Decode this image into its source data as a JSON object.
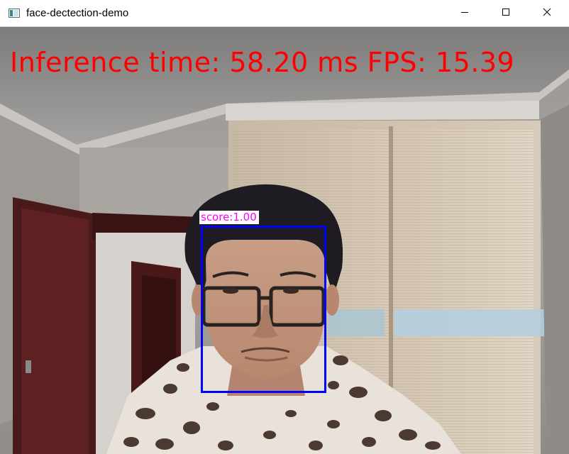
{
  "window": {
    "title": "face-dectection-demo",
    "icon": "app-window-icon",
    "controls": {
      "minimize": "minimize-icon",
      "maximize": "maximize-icon",
      "close": "close-icon"
    }
  },
  "overlay": {
    "inference_text": "Inference time: 58.20 ms FPS: 15.39",
    "text_color": "#ff0000"
  },
  "detections": [
    {
      "score_label": "score:1.00",
      "box_color": "#0000ff",
      "label_color": "#ff00ff"
    }
  ]
}
